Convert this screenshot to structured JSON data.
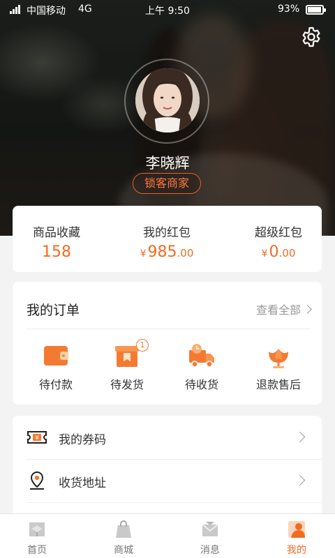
{
  "status_bar": {
    "carrier": "中国移动",
    "network": "4G",
    "time": "上午 9:50",
    "battery": "93%",
    "battery_level": 0.93
  },
  "profile": {
    "name": "李晓辉",
    "tag": "锁客商家",
    "avatar_icon": "user-avatar-photo",
    "settings_icon": "gear-icon"
  },
  "stats": [
    {
      "label": "商品收藏",
      "value": "158"
    },
    {
      "label": "我的红包",
      "currency": "¥",
      "int": "985",
      "cents": ".00"
    },
    {
      "label": "超级红包",
      "currency": "¥",
      "int": "0",
      "cents": ".00"
    }
  ],
  "orders": {
    "title": "我的订单",
    "view_all": "查看全部",
    "items": [
      {
        "label": "待付款",
        "icon": "wallet-icon"
      },
      {
        "label": "待发货",
        "icon": "package-icon",
        "badge": "1"
      },
      {
        "label": "待收货",
        "icon": "delivery-truck-icon"
      },
      {
        "label": "退款售后",
        "icon": "tulip-refund-icon"
      }
    ]
  },
  "menu": [
    {
      "label": "我的券码",
      "icon": "coupon-icon"
    },
    {
      "label": "收货地址",
      "icon": "location-pin-icon"
    }
  ],
  "tabs": [
    {
      "label": "首页",
      "icon": "home-icon"
    },
    {
      "label": "商城",
      "icon": "shopping-bag-icon"
    },
    {
      "label": "消息",
      "icon": "message-icon"
    },
    {
      "label": "我的",
      "icon": "profile-icon",
      "active": true
    }
  ],
  "colors": {
    "accent": "#f26b21",
    "background": "#f3f3f3"
  }
}
